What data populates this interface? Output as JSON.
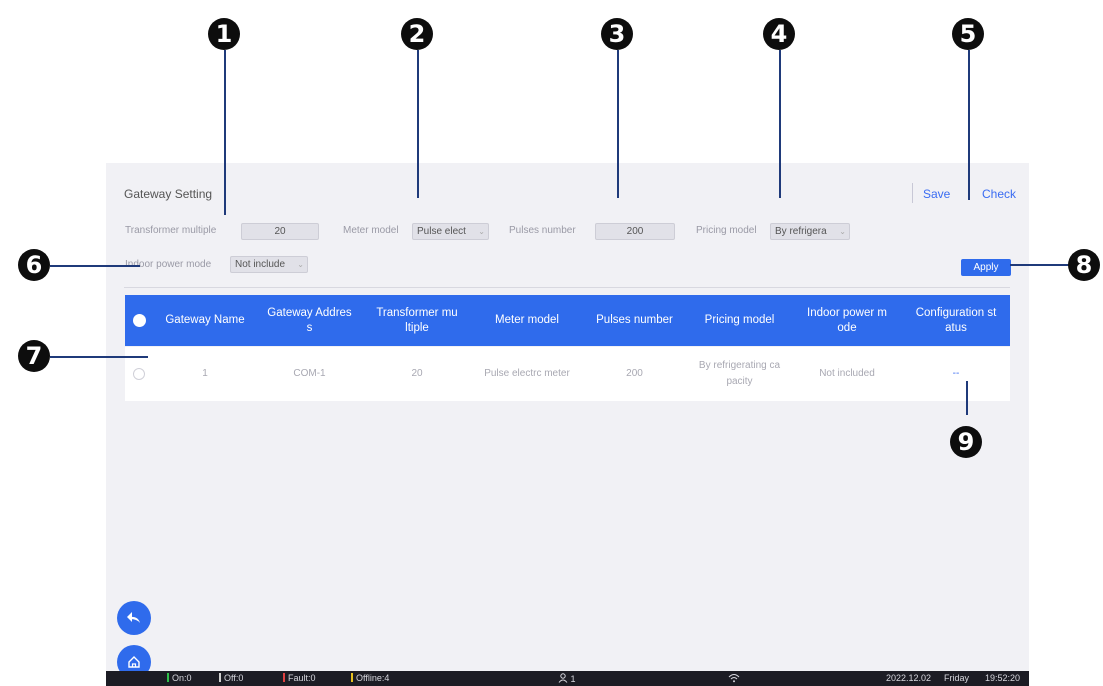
{
  "header": {
    "title": "Gateway Setting",
    "save_label": "Save",
    "check_label": "Check"
  },
  "form": {
    "transformer_multiple": {
      "label": "Transformer multiple",
      "value": "20"
    },
    "meter_model": {
      "label": "Meter model",
      "value": "Pulse elect"
    },
    "pulses_number": {
      "label": "Pulses number",
      "value": "200"
    },
    "pricing_model": {
      "label": "Pricing model",
      "value": "By refrigera"
    },
    "indoor_power_mode": {
      "label": "Indoor power mode",
      "value": "Not include"
    },
    "apply_label": "Apply"
  },
  "table": {
    "columns": [
      "Gateway Name",
      "Gateway Addres\ns",
      "Transformer mu\nltiple",
      "Meter model",
      "Pulses number",
      "Pricing model",
      "Indoor power m\node",
      "Configuration st\natus"
    ],
    "rows": [
      [
        "1",
        "COM-1",
        "20",
        "Pulse electrc meter",
        "200",
        "By refrigerating ca\npacity",
        "Not included",
        "--"
      ]
    ]
  },
  "status_bar": {
    "on": "On:0",
    "off": "Off:0",
    "fault": "Fault:0",
    "offline": "Offline:4",
    "user_count": "1",
    "date": "2022.12.02",
    "weekday": "Friday",
    "time": "19:52:20",
    "colors": {
      "on": "#2fbf4a",
      "off": "#cfcfcf",
      "fault": "#e04040",
      "offline": "#e6c020"
    }
  },
  "callouts": [
    "1",
    "2",
    "3",
    "4",
    "5",
    "6",
    "7",
    "8",
    "9"
  ],
  "icons": {
    "back": "back-arrow-icon",
    "home": "home-icon",
    "user": "user-icon",
    "wifi": "wifi-icon"
  },
  "colors": {
    "accent": "#2f6bec",
    "callout": "#0d0d0d",
    "leader_line": "#1f3a7a"
  }
}
